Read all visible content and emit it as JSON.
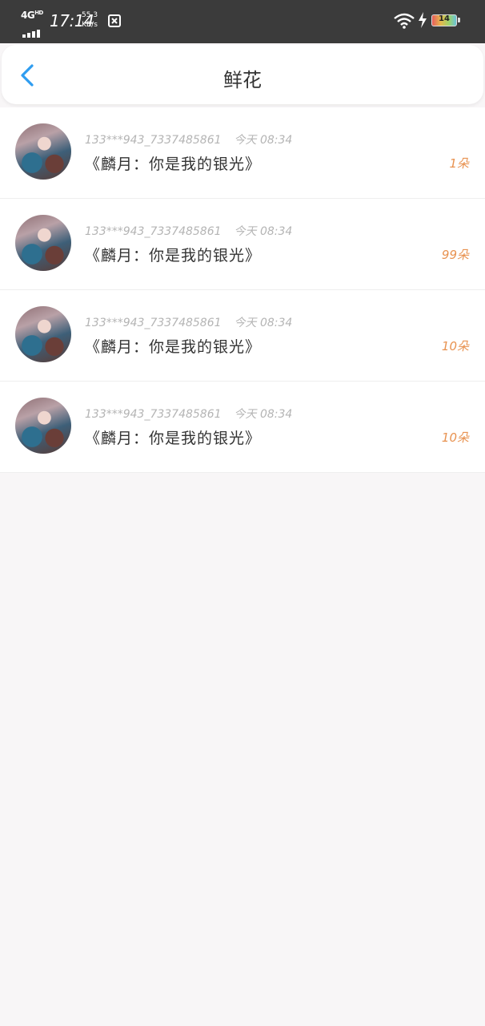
{
  "status_bar": {
    "network": "4G",
    "network_hd": "HD",
    "time": "17:14",
    "speed_value": "55.3",
    "speed_unit": "KB/s",
    "battery": "14"
  },
  "nav": {
    "back_icon": "chevron-left-icon",
    "title": "鲜花"
  },
  "colors": {
    "accent": "#2f9df0",
    "count": "#e89250",
    "meta": "#b4b4b4"
  },
  "rows": [
    {
      "user": "133***943_7337485861",
      "time": "今天 08:34",
      "message": "《麟月：你是我的银光》",
      "count": "1朵"
    },
    {
      "user": "133***943_7337485861",
      "time": "今天 08:34",
      "message": "《麟月：你是我的银光》",
      "count": "99朵"
    },
    {
      "user": "133***943_7337485861",
      "time": "今天 08:34",
      "message": "《麟月：你是我的银光》",
      "count": "10朵"
    },
    {
      "user": "133***943_7337485861",
      "time": "今天 08:34",
      "message": "《麟月：你是我的银光》",
      "count": "10朵"
    }
  ]
}
